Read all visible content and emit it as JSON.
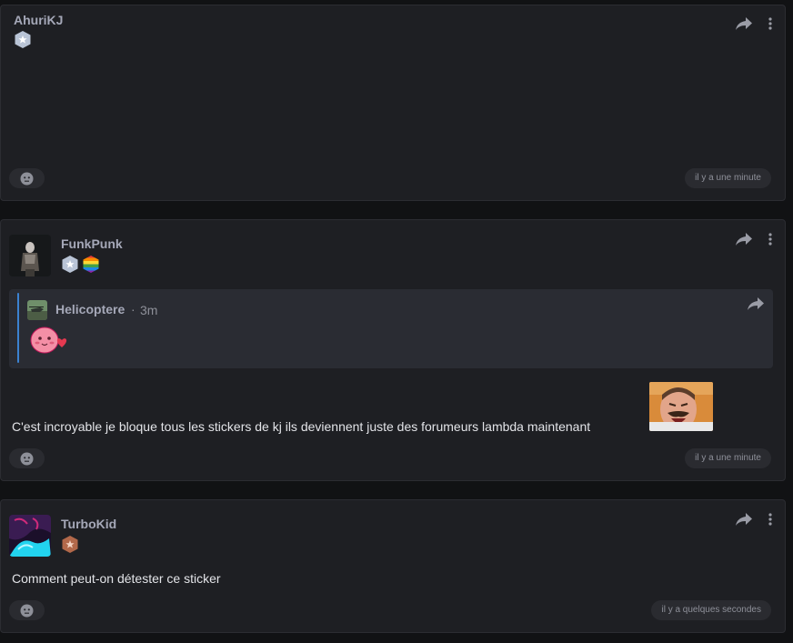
{
  "colors": {
    "background": "#111214",
    "card": "#1e1f23",
    "username": "#a5a8b8",
    "quote_accent": "#3b82d1",
    "badge_silver": "#b9c4d6",
    "badge_bronze": "#b2684a"
  },
  "posts": [
    {
      "username": "AhuriKJ",
      "badges": [
        "silver-star-badge"
      ],
      "text": "",
      "timestamp": "il y a une minute"
    },
    {
      "username": "FunkPunk",
      "badges": [
        "silver-star-badge",
        "rainbow-badge"
      ],
      "quote": {
        "author": "Helicoptere",
        "separator": "·",
        "time": "3m",
        "sticker": "pink-blob-heart-sticker"
      },
      "text": "C'est incroyable je bloque tous les stickers de kj ils deviennent juste des forumeurs lambda maintenant",
      "inline_sticker": "laughing-man-sticker",
      "timestamp": "il y a une minute"
    },
    {
      "username": "TurboKid",
      "badges": [
        "bronze-star-badge"
      ],
      "text": "Comment peut-on détester ce sticker",
      "timestamp": "il y a quelques secondes"
    }
  ]
}
